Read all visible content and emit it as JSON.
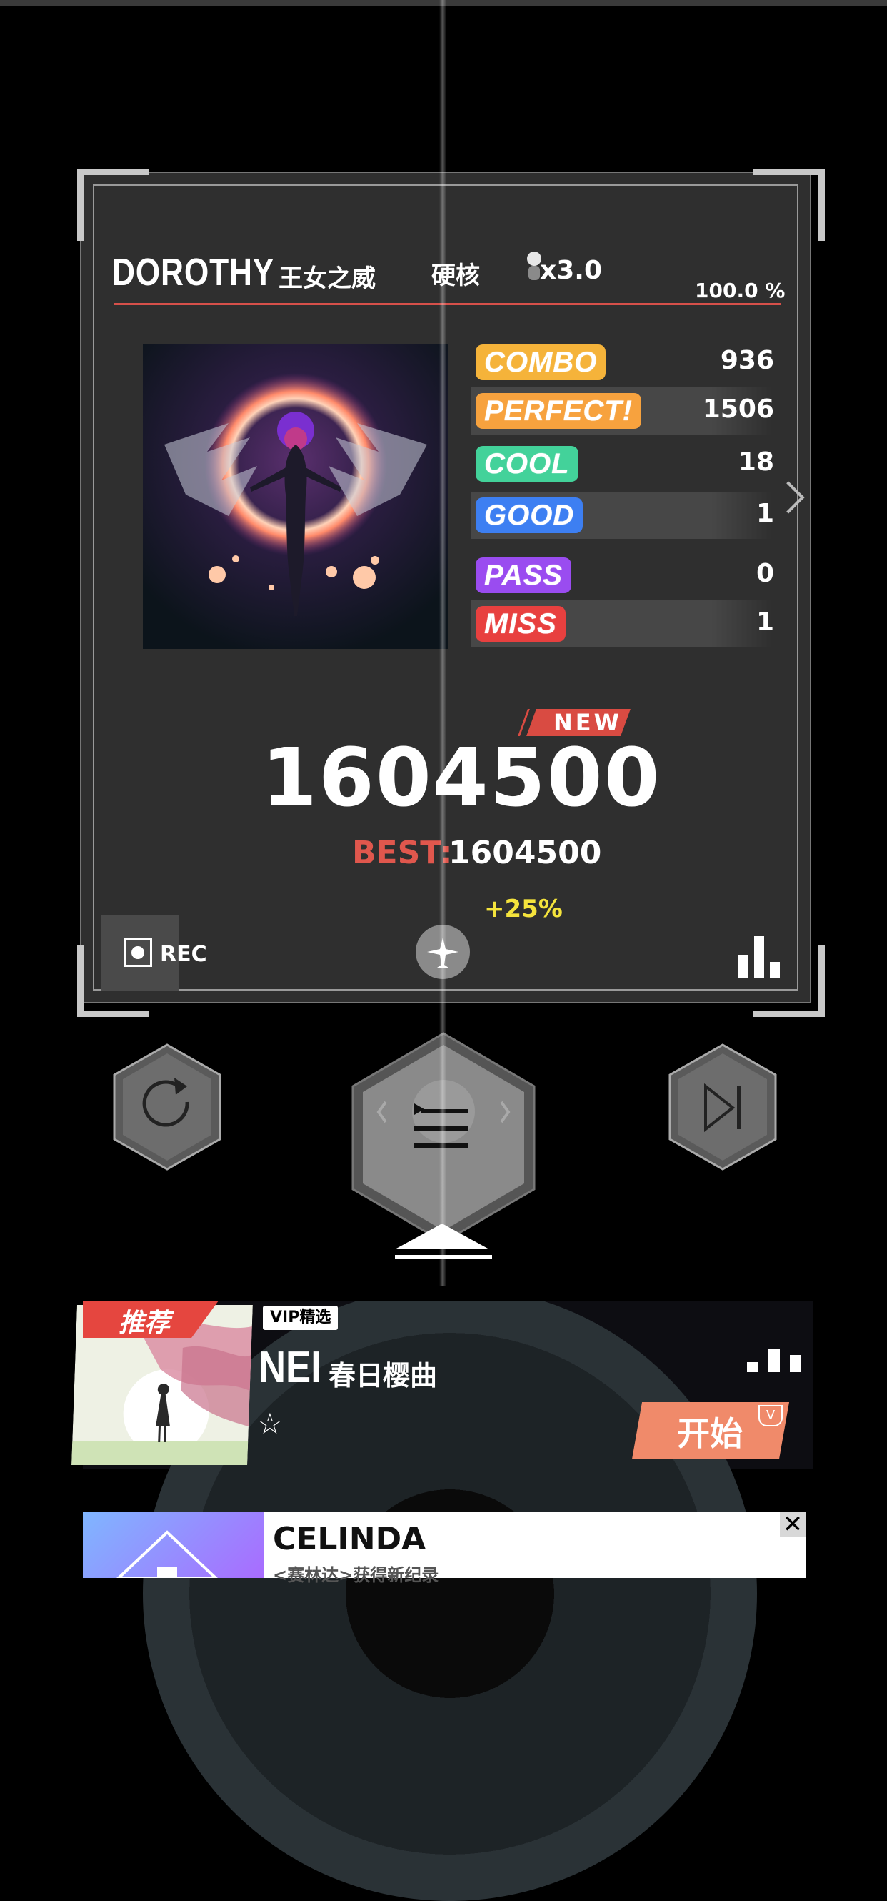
{
  "result": {
    "artist": "DOROTHY",
    "song": "王女之威",
    "difficulty": "硬核",
    "speed": "x3.0",
    "accuracy": "100.0 %",
    "stats": [
      {
        "label": "COMBO",
        "value": "936",
        "color": "#f5b33a"
      },
      {
        "label": "PERFECT!",
        "value": "1506",
        "color": "#f7a23e"
      },
      {
        "label": "COOL",
        "value": "18",
        "color": "#43d29a"
      },
      {
        "label": "GOOD",
        "value": "1",
        "color": "#3d7ff2"
      },
      {
        "label": "PASS",
        "value": "0",
        "color": "#9a4cf0"
      },
      {
        "label": "MISS",
        "value": "1",
        "color": "#e8403f"
      }
    ],
    "new_badge": "NEW",
    "score": "1604500",
    "best_label": "BEST:",
    "best_value": "1604500",
    "bonus": "+25%",
    "rec_label": "REC"
  },
  "icons": {
    "retry": "retry-icon",
    "menu": "menu-icon",
    "next": "next-icon",
    "plane": "plane-icon",
    "chart": "bar-chart-icon",
    "close": "close-icon"
  },
  "recommend_card": {
    "tag": "推荐",
    "vip": "VIP精选",
    "artist": "NEI",
    "song": "春日樱曲",
    "star": "☆",
    "start": "开始",
    "start_badge": "V"
  },
  "ad": {
    "title": "CELINDA",
    "subtitle": "<赛林达>获得新纪录",
    "close": "✕"
  }
}
